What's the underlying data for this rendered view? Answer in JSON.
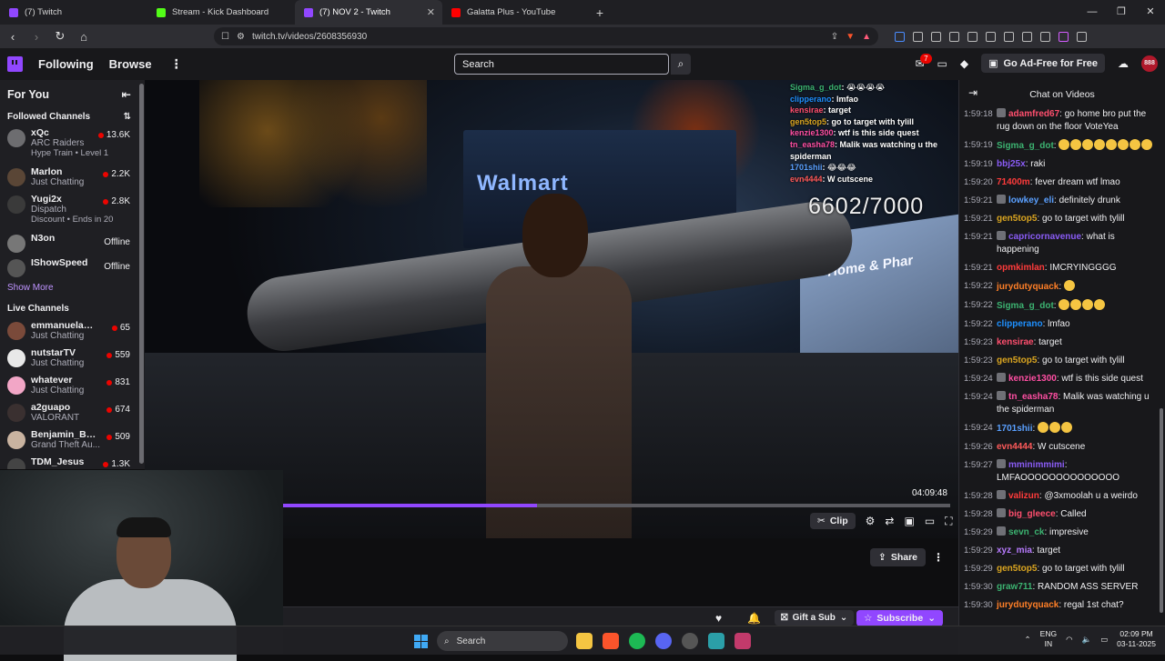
{
  "browser": {
    "tabs": [
      {
        "title": "(7) Twitch",
        "color": "#9147ff"
      },
      {
        "title": "Stream - Kick Dashboard",
        "color": "#53fc18"
      },
      {
        "title": "(7) NOV 2 - Twitch",
        "color": "#9147ff",
        "active": true
      },
      {
        "title": "Galatta Plus - YouTube",
        "color": "#ff0000"
      }
    ],
    "url": "twitch.tv/videos/2608356930"
  },
  "topnav": {
    "following": "Following",
    "browse": "Browse",
    "search_placeholder": "Search",
    "notifications_count": "7",
    "ad_free": "Go Ad-Free for Free",
    "avatar_text": "888"
  },
  "sidebar": {
    "for_you": "For You",
    "followed_header": "Followed Channels",
    "followed": [
      {
        "name": "xQc",
        "game": "ARC Raiders",
        "extra": "Hype Train • Level 1",
        "viewers": "13.6K",
        "color": "#6d6d70"
      },
      {
        "name": "Marlon",
        "game": "Just Chatting",
        "extra": "",
        "viewers": "2.2K",
        "color": "#5a4636"
      },
      {
        "name": "Yugi2x",
        "game": "Dispatch",
        "extra": "Discount • Ends in 20",
        "viewers": "2.8K",
        "color": "#3a3a3a"
      },
      {
        "name": "N3on",
        "game": "",
        "extra": "",
        "status": "Offline",
        "color": "#777"
      },
      {
        "name": "IShowSpeed",
        "game": "",
        "extra": "",
        "status": "Offline",
        "color": "#555"
      }
    ],
    "show_more": "Show More",
    "live_header": "Live Channels",
    "live": [
      {
        "name": "emmanuelach...",
        "game": "Just Chatting",
        "viewers": "65",
        "color": "#7a4a3a"
      },
      {
        "name": "nutstarTV",
        "game": "Just Chatting",
        "viewers": "559",
        "color": "#e8e8e8"
      },
      {
        "name": "whatever",
        "game": "Just Chatting",
        "viewers": "831",
        "color": "#f2a6c6"
      },
      {
        "name": "a2guapo",
        "game": "VALORANT",
        "viewers": "674",
        "color": "#3a3030"
      },
      {
        "name": "Benjamin_Bucks",
        "game": "Grand Theft Au...",
        "viewers": "509",
        "color": "#c9b3a0"
      },
      {
        "name": "TDM_Jesus",
        "game": "",
        "viewers": "1.3K",
        "color": "#444"
      }
    ]
  },
  "video": {
    "store_sign": "Walmart",
    "store_sign2": "Home & Phar",
    "counter": "6602/7000",
    "progress": 0.38,
    "duration": "04:09:48",
    "clip_label": "Clip",
    "overlay_chat": [
      {
        "user": "Sigma_g_dot",
        "msg": "😭😭😭😭",
        "color": "#3cb371"
      },
      {
        "user": "clipperano",
        "msg": "lmfao",
        "color": "#1e90ff"
      },
      {
        "user": "kensirae",
        "msg": "target",
        "color": "#ff4f6e"
      },
      {
        "user": "gen5top5",
        "msg": "go to target with tylill",
        "color": "#daa520"
      },
      {
        "user": "kenzie1300",
        "msg": "wtf is this side quest",
        "color": "#ff4fa3"
      },
      {
        "user": "tn_easha78",
        "msg": "Malik was watching u the spiderman",
        "color": "#ff4fa3"
      },
      {
        "user": "1701shii",
        "msg": "😂😂😂",
        "color": "#5aa0ff"
      },
      {
        "user": "evn4444",
        "msg": "W cutscene",
        "color": "#ff5a5a"
      }
    ]
  },
  "below_video": {
    "share": "Share",
    "gift_sub": "Gift a Sub",
    "subscribe": "Subscribe"
  },
  "chat": {
    "title": "Chat on Videos",
    "messages": [
      {
        "time": "1:59:18",
        "user": "adamfred67",
        "msg": "go home bro put the rug down on the floor VoteYea",
        "color": "#ff4f6e",
        "badge": true
      },
      {
        "time": "1:59:19",
        "user": "Sigma_g_dot",
        "msg": "",
        "emotes": 8,
        "color": "#3cb371"
      },
      {
        "time": "1:59:19",
        "user": "bbj25x",
        "msg": "raki",
        "color": "#8a5cf6"
      },
      {
        "time": "1:59:20",
        "user": "71400m",
        "msg": "fever dream wtf lmao",
        "color": "#ff3b3b"
      },
      {
        "time": "1:59:21",
        "user": "lowkey_eli",
        "msg": "definitely drunk",
        "color": "#5aa0ff",
        "badge": true
      },
      {
        "time": "1:59:21",
        "user": "gen5top5",
        "msg": "go to target with tylill",
        "color": "#daa520"
      },
      {
        "time": "1:59:21",
        "user": "capricornavenue",
        "msg": "what is happening",
        "color": "#8a5cf6",
        "badge": true
      },
      {
        "time": "1:59:21",
        "user": "opmkimlan",
        "msg": "IMCRYINGGGG",
        "color": "#ff3b3b"
      },
      {
        "time": "1:59:22",
        "user": "jurydutyquack",
        "msg": "",
        "emotes": 1,
        "color": "#ff7f27"
      },
      {
        "time": "1:59:22",
        "user": "Sigma_g_dot",
        "msg": "",
        "emotes": 4,
        "color": "#3cb371"
      },
      {
        "time": "1:59:22",
        "user": "clipperano",
        "msg": "lmfao",
        "color": "#1e90ff"
      },
      {
        "time": "1:59:23",
        "user": "kensirae",
        "msg": "target",
        "color": "#ff4f6e"
      },
      {
        "time": "1:59:23",
        "user": "gen5top5",
        "msg": "go to target with tylill",
        "color": "#daa520"
      },
      {
        "time": "1:59:24",
        "user": "kenzie1300",
        "msg": "wtf is this side quest",
        "color": "#ff4fa3",
        "badge": true
      },
      {
        "time": "1:59:24",
        "user": "tn_easha78",
        "msg": "Malik was watching u the spiderman",
        "color": "#ff4fa3",
        "badge": true
      },
      {
        "time": "1:59:24",
        "user": "1701shii",
        "msg": "",
        "emotes": 3,
        "color": "#5aa0ff"
      },
      {
        "time": "1:59:26",
        "user": "evn4444",
        "msg": "W cutscene",
        "color": "#ff5a5a"
      },
      {
        "time": "1:59:27",
        "user": "mminimmimi",
        "msg": "LMFAOOOOOOOOOOOOOO",
        "color": "#8a5cf6",
        "badge": true
      },
      {
        "time": "1:59:28",
        "user": "valizun",
        "msg": "@3xmoolah u a weirdo",
        "color": "#ff3b3b",
        "badge": true
      },
      {
        "time": "1:59:28",
        "user": "big_gleece",
        "msg": "Called",
        "color": "#ff4f6e",
        "badge": true
      },
      {
        "time": "1:59:29",
        "user": "sevn_ck",
        "msg": "impresive",
        "color": "#3cb371",
        "badge": true
      },
      {
        "time": "1:59:29",
        "user": "xyz_mia",
        "msg": "target",
        "color": "#b87bff"
      },
      {
        "time": "1:59:29",
        "user": "gen5top5",
        "msg": "go to target with tylill",
        "color": "#daa520"
      },
      {
        "time": "1:59:30",
        "user": "graw711",
        "msg": "RANDOM ASS SERVER",
        "color": "#3cb371"
      },
      {
        "time": "1:59:30",
        "user": "jurydutyquack",
        "msg": "regal 1st chat?",
        "color": "#ff7f27"
      }
    ]
  },
  "taskbar": {
    "search": "Search",
    "lang1": "ENG",
    "lang2": "IN",
    "time": "02:09 PM",
    "date": "03-11-2025"
  }
}
